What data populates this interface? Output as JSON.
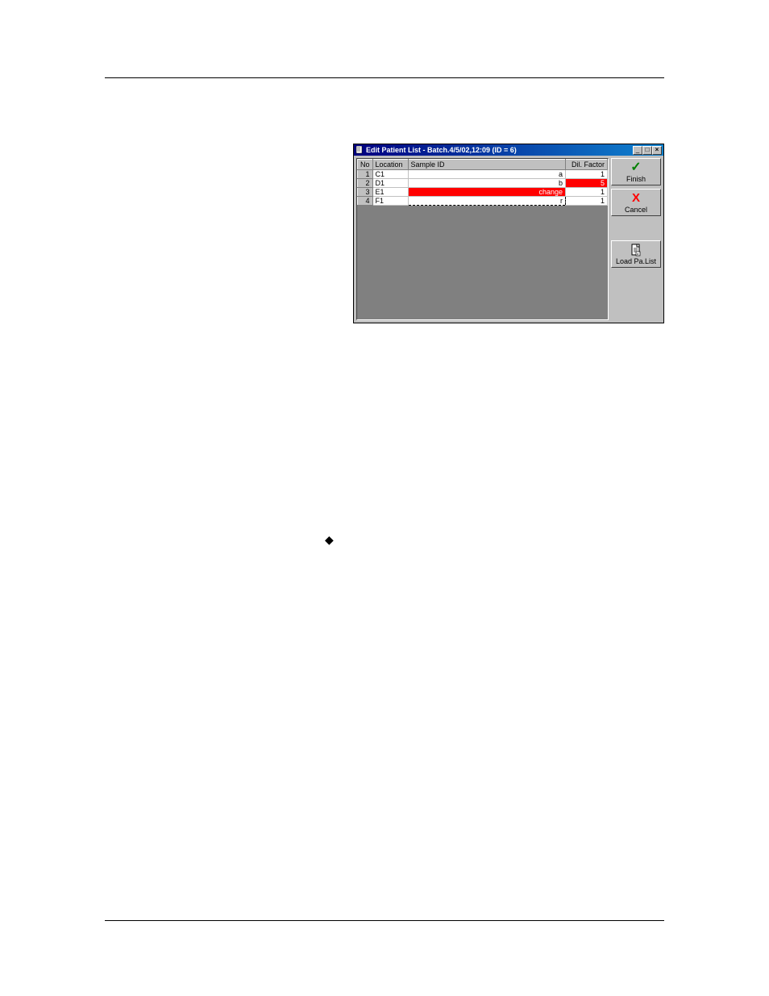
{
  "hr": {},
  "window": {
    "title": "Edit Patient List - Batch.4/5/02,12:09 (ID = 6)",
    "icon_name": "doc-icon"
  },
  "columns": {
    "no": "No",
    "location": "Location",
    "sample_id": "Sample ID",
    "dil_factor": "Dil. Factor"
  },
  "rows": [
    {
      "no": "1",
      "location": "C1",
      "sample_id": "a",
      "dil": "1",
      "highlight_sample": false,
      "highlight_dil": false,
      "editing": false
    },
    {
      "no": "2",
      "location": "D1",
      "sample_id": "b",
      "dil": "5",
      "highlight_sample": false,
      "highlight_dil": true,
      "editing": false
    },
    {
      "no": "3",
      "location": "E1",
      "sample_id": "change",
      "dil": "1",
      "highlight_sample": true,
      "highlight_dil": false,
      "editing": false
    },
    {
      "no": "4",
      "location": "F1",
      "sample_id": "r",
      "dil": "1",
      "highlight_sample": false,
      "highlight_dil": false,
      "editing": true
    }
  ],
  "buttons": {
    "finish": "Finish",
    "cancel": "Cancel",
    "load": "Load Pa.List"
  },
  "titlebar_controls": {
    "minimize": "_",
    "maximize": "□",
    "close": "×"
  },
  "decor": {
    "diamond": "◆"
  }
}
